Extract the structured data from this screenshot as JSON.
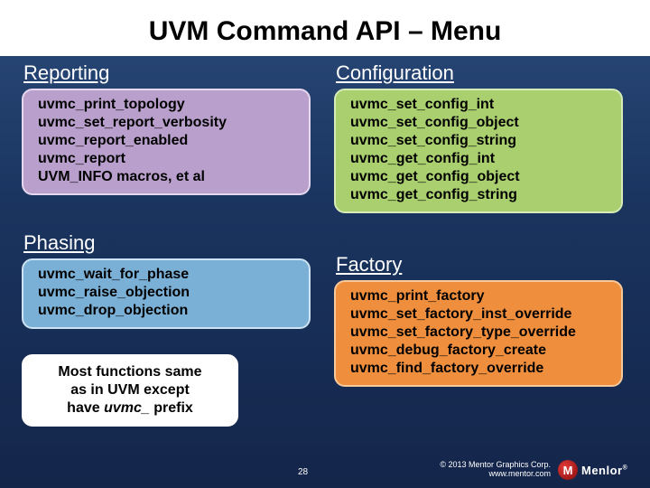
{
  "title": "UVM Command API – Menu",
  "reporting": {
    "header": "Reporting",
    "items": [
      "uvmc_print_topology",
      "uvmc_set_report_verbosity",
      "uvmc_report_enabled",
      "uvmc_report",
      "UVM_INFO macros, et al"
    ]
  },
  "phasing": {
    "header": "Phasing",
    "items": [
      "uvmc_wait_for_phase",
      "uvmc_raise_objection",
      "uvmc_drop_objection"
    ]
  },
  "note": {
    "line1": "Most functions same",
    "line2": "as in UVM except",
    "line3_prefix": "have ",
    "line3_em": "uvmc_",
    "line3_suffix": " prefix"
  },
  "configuration": {
    "header": "Configuration",
    "items": [
      "uvmc_set_config_int",
      "uvmc_set_config_object",
      "uvmc_set_config_string",
      "uvmc_get_config_int",
      "uvmc_get_config_object",
      "uvmc_get_config_string"
    ]
  },
  "factory": {
    "header": "Factory",
    "items": [
      "uvmc_print_factory",
      "uvmc_set_factory_inst_override",
      "uvmc_set_factory_type_override",
      "uvmc_debug_factory_create",
      "uvmc_find_factory_override"
    ]
  },
  "footer": {
    "slide_number": "28",
    "copyright_line1": "© 2013 Mentor Graphics Corp.",
    "copyright_line2": "www.mentor.com",
    "logo_text": "Menlor"
  }
}
